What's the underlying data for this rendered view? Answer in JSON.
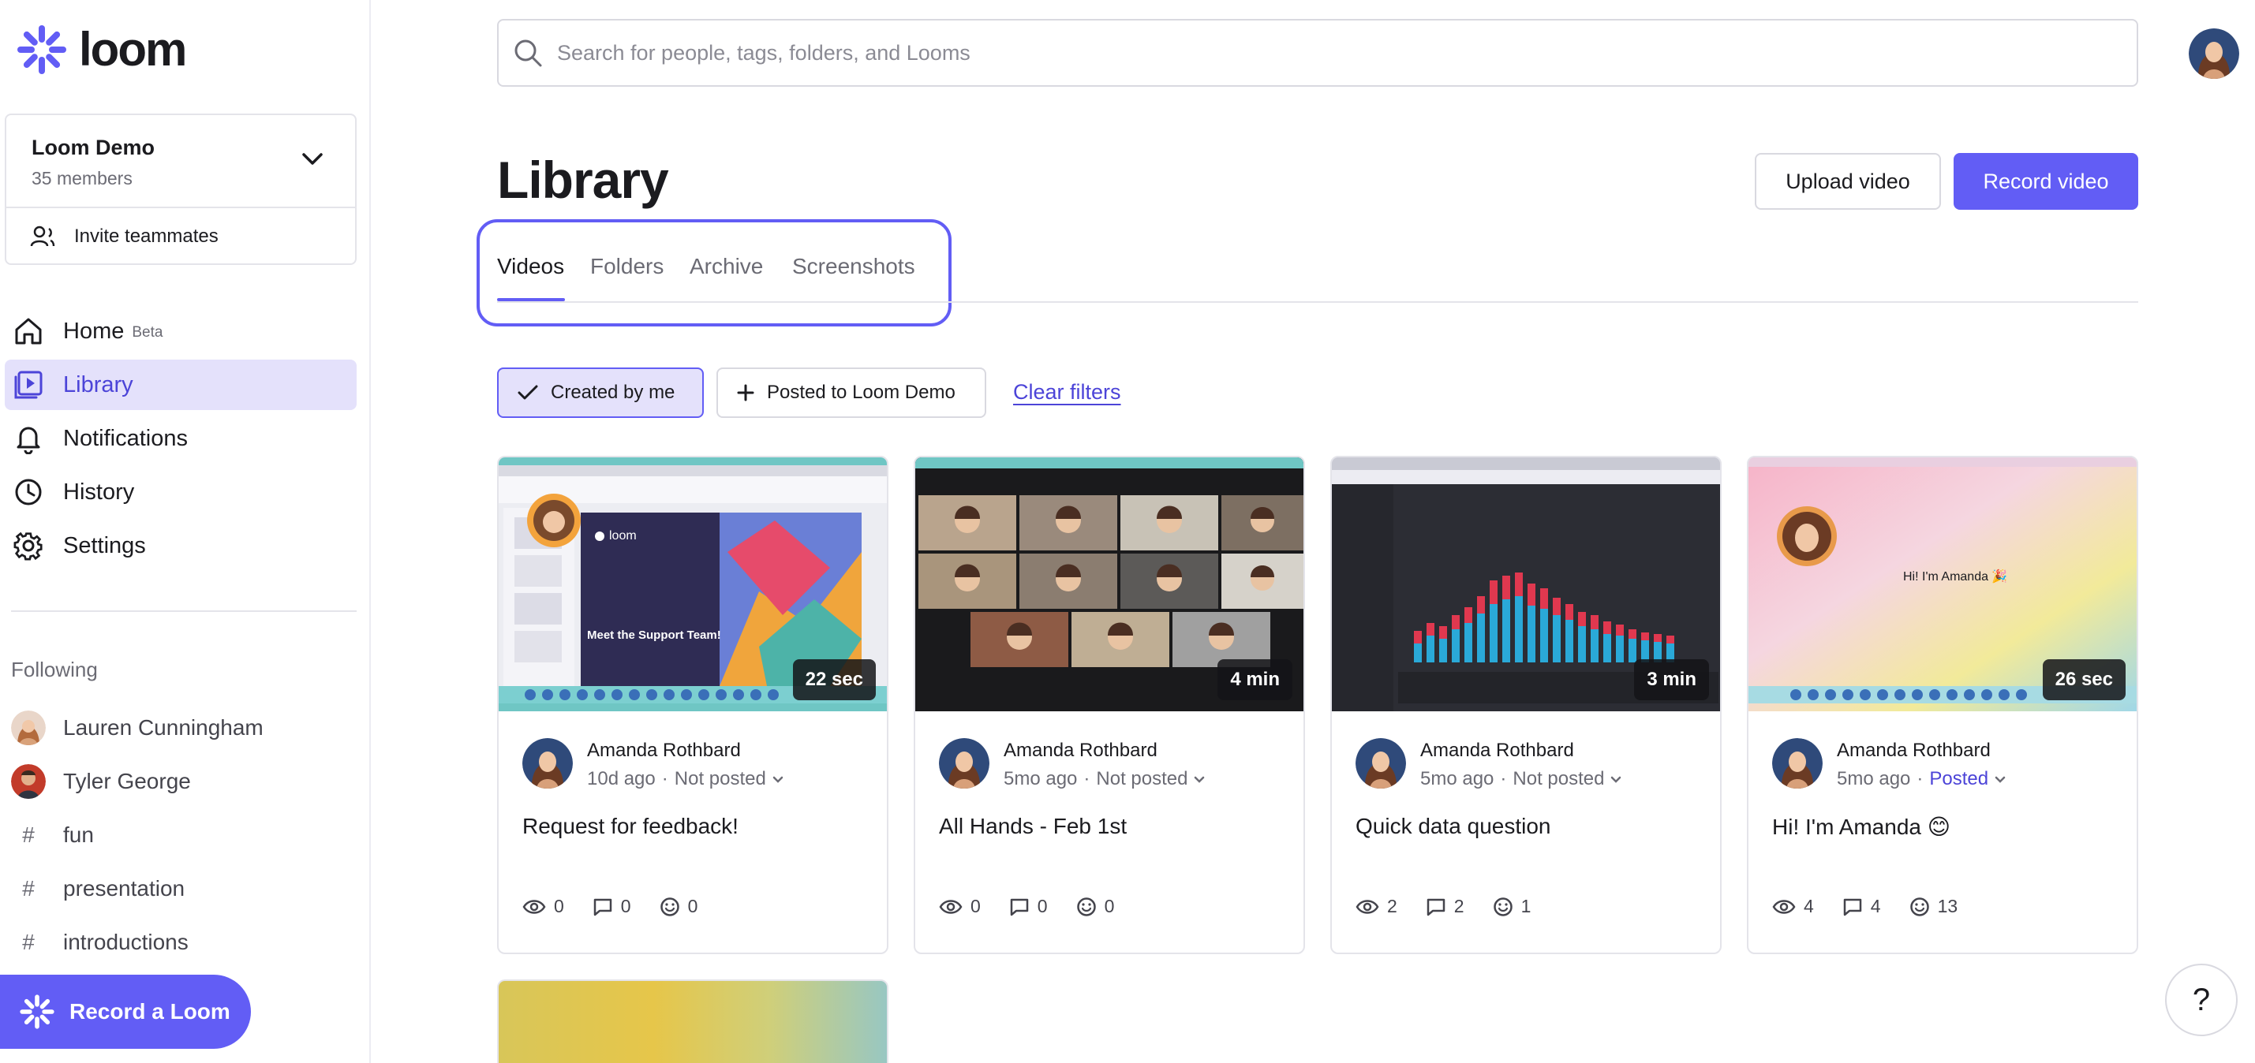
{
  "brand": {
    "name": "loom",
    "accent": "#625df5"
  },
  "workspace": {
    "name": "Loom Demo",
    "members": "35 members",
    "invite_label": "Invite teammates"
  },
  "nav": {
    "items": [
      {
        "label": "Home",
        "icon": "home-icon",
        "badge": "Beta"
      },
      {
        "label": "Library",
        "icon": "library-icon",
        "active": true
      },
      {
        "label": "Notifications",
        "icon": "bell-icon"
      },
      {
        "label": "History",
        "icon": "clock-icon"
      },
      {
        "label": "Settings",
        "icon": "gear-icon"
      }
    ]
  },
  "following": {
    "title": "Following",
    "items": [
      {
        "label": "Lauren Cunningham",
        "type": "person"
      },
      {
        "label": "Tyler George",
        "type": "person"
      },
      {
        "label": "fun",
        "type": "tag"
      },
      {
        "label": "presentation",
        "type": "tag"
      },
      {
        "label": "introductions",
        "type": "tag"
      }
    ]
  },
  "record_loom_label": "Record a Loom",
  "search": {
    "placeholder": "Search for people, tags, folders, and Looms"
  },
  "page": {
    "title": "Library",
    "upload_label": "Upload video",
    "record_label": "Record video"
  },
  "tabs": [
    {
      "label": "Videos",
      "active": true
    },
    {
      "label": "Folders"
    },
    {
      "label": "Archive"
    },
    {
      "label": "Screenshots"
    }
  ],
  "filters": {
    "created_by_me": "Created by me",
    "posted_to": "Posted to Loom Demo",
    "clear": "Clear filters"
  },
  "videos": [
    {
      "author": "Amanda Rothbard",
      "age": "10d ago",
      "status": "Not posted",
      "title": "Request for feedback!",
      "duration": "22 sec",
      "views": "0",
      "comments": "0",
      "reactions": "0",
      "thumb_text": "Meet the Support Team!",
      "thumb_logo": "loom"
    },
    {
      "author": "Amanda Rothbard",
      "age": "5mo ago",
      "status": "Not posted",
      "title": "All Hands - Feb 1st",
      "duration": "4 min",
      "views": "0",
      "comments": "0",
      "reactions": "0"
    },
    {
      "author": "Amanda Rothbard",
      "age": "5mo ago",
      "status": "Not posted",
      "title": "Quick data question",
      "duration": "3 min",
      "views": "2",
      "comments": "2",
      "reactions": "1"
    },
    {
      "author": "Amanda Rothbard",
      "age": "5mo ago",
      "status": "Posted",
      "title": "Hi! I'm Amanda 😊",
      "duration": "26 sec",
      "views": "4",
      "comments": "4",
      "reactions": "13",
      "thumb_text": "Hi! I'm Amanda 🎉"
    }
  ],
  "help_label": "?"
}
